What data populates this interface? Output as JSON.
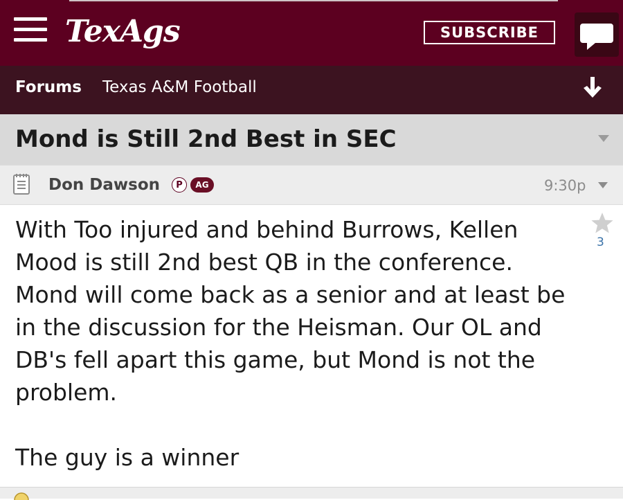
{
  "header": {
    "logo_text": "TexAgs",
    "subscribe_label": "SUBSCRIBE",
    "brand_color": "#5c0020",
    "icons": [
      "hamburger-menu-icon",
      "chat-bubble-icon"
    ]
  },
  "nav": {
    "forums_label": "Forums",
    "forum_name": "Texas A&M Football",
    "icons": [
      "arrow-down-icon"
    ]
  },
  "thread": {
    "title": "Mond is Still 2nd Best in SEC"
  },
  "post": {
    "author": "Don Dawson",
    "badge_p": "P",
    "badge_ag": "AG",
    "time": "9:30p",
    "star_count": "3",
    "paragraphs": [
      "With Too injured and behind Burrows, Kellen Mood is still 2nd best QB in the conference. Mond will come back as a senior and at least be in the discussion for the Heisman. Our OL and DB's fell apart this game, but Mond is not the problem.",
      "The guy is a winner"
    ],
    "icons": [
      "notepad-icon",
      "star-icon",
      "caret-down-icon"
    ]
  }
}
